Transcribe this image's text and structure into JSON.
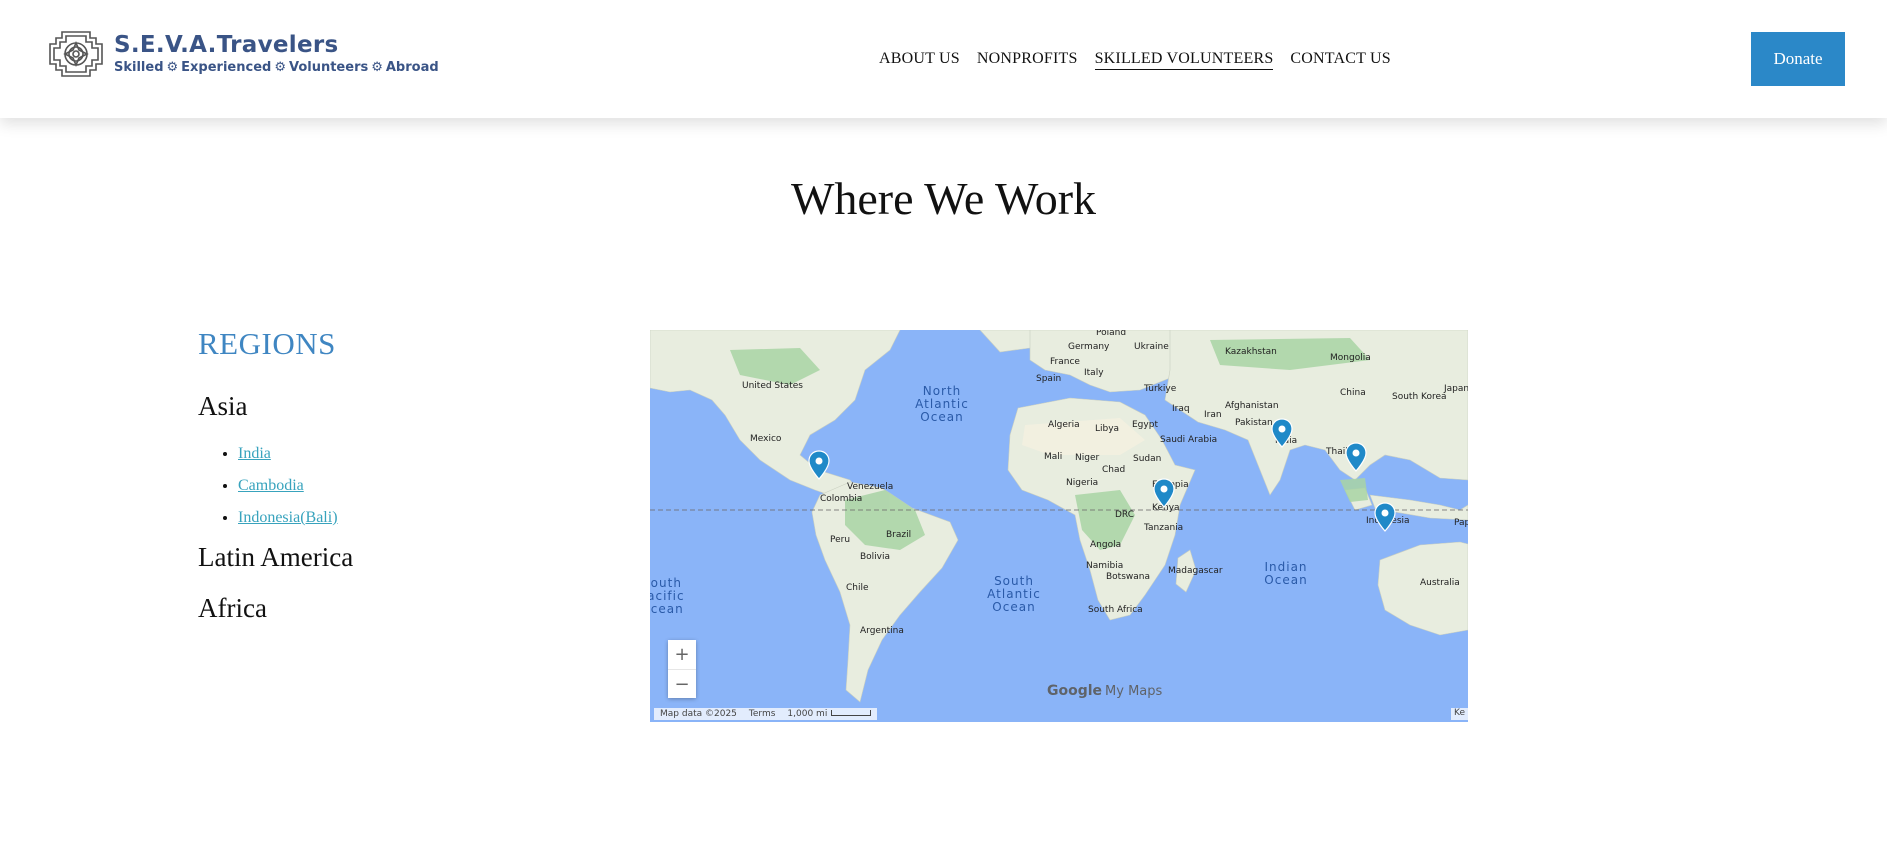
{
  "header": {
    "logo": {
      "title": "S.E.V.A.Travelers",
      "tagline": [
        "Skilled",
        "Experienced",
        "Volunteers",
        "Abroad"
      ]
    },
    "nav": [
      {
        "label": "ABOUT US",
        "active": false
      },
      {
        "label": "NONPROFITS",
        "active": false
      },
      {
        "label": "SKILLED VOLUNTEERS",
        "active": true
      },
      {
        "label": "CONTACT US",
        "active": false
      }
    ],
    "donate_label": "Donate"
  },
  "page_title": "Where We Work",
  "sidebar": {
    "heading": "REGIONS",
    "regions": {
      "asia": {
        "label": "Asia",
        "countries": [
          "India",
          "Cambodia",
          "Indonesia(Bali)"
        ]
      },
      "latin_america": {
        "label": "Latin America"
      },
      "africa": {
        "label": "Africa"
      }
    }
  },
  "map": {
    "country_labels": [
      "Poland",
      "Germany",
      "Ukraine",
      "Kazakhstan",
      "Mongolia",
      "France",
      "Italy",
      "Spain",
      "Türkiye",
      "China",
      "South Korea",
      "Japan",
      "United States",
      "Iraq",
      "Iran",
      "Afghanistan",
      "Pakistan",
      "India",
      "Algeria",
      "Libya",
      "Egypt",
      "Saudi Arabia",
      "Mexico",
      "Mali",
      "Niger",
      "Sudan",
      "Chad",
      "Thailand",
      "Venezuela",
      "Colombia",
      "Nigeria",
      "Ethiopia",
      "DRC",
      "Kenya",
      "Tanzania",
      "Indonesia",
      "Brazil",
      "Peru",
      "Bolivia",
      "Angola",
      "Namibia",
      "Botswana",
      "Madagascar",
      "Chile",
      "South Africa",
      "Argentina",
      "Australia",
      "Papua New Guinea"
    ],
    "ocean_labels": {
      "north_atlantic": "North Atlantic Ocean",
      "south_atlantic": "South Atlantic Ocean",
      "indian": "Indian Ocean",
      "south_pacific": "South Pacific Ocean"
    },
    "markers": [
      "Colombia",
      "Kenya",
      "India",
      "Cambodia",
      "Indonesia"
    ],
    "zoom_in": "+",
    "zoom_out": "−",
    "brand": "Google",
    "brand_product": "My Maps",
    "attribution": {
      "map_data": "Map data ©2025",
      "terms": "Terms",
      "scale": "1,000 mi",
      "keyboard": "Ke"
    },
    "colors": {
      "ocean": "#8ab4f8",
      "land": "#e8eddf",
      "forest": "#a8d3a5",
      "marker": "#1f89c8"
    }
  }
}
